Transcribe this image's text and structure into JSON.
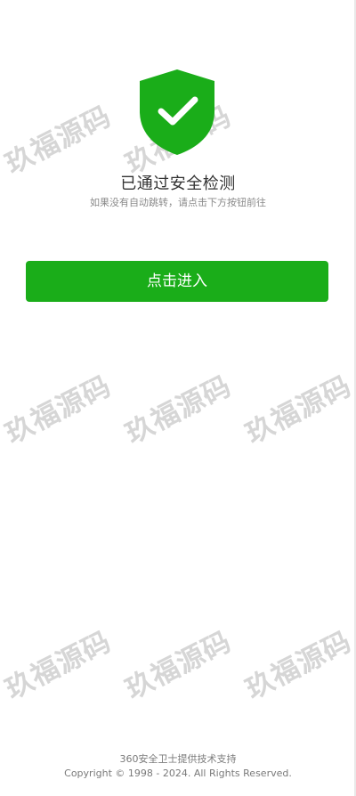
{
  "status": {
    "title": "已通过安全检测",
    "subtitle": "如果没有自动跳转，请点击下方按钮前往",
    "icon": "shield-check-icon"
  },
  "button": {
    "label": "点击进入"
  },
  "watermark": {
    "text": "玖福源码"
  },
  "footer": {
    "support": "360安全卫士提供技术支持",
    "copyright": "Copyright © 1998 - 2024. All Rights Reserved."
  },
  "colors": {
    "accent": "#1aad19",
    "background": "#ffffff",
    "title_text": "#333333",
    "secondary_text": "#8a8a8a",
    "watermark_text": "#d4d4d4"
  }
}
